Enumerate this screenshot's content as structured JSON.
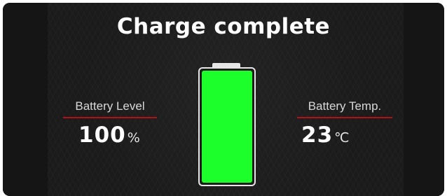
{
  "header": {
    "title": "Charge complete"
  },
  "battery_level": {
    "label": "Battery Level",
    "value": "100",
    "unit": "%"
  },
  "battery_temp": {
    "label": "Battery Temp.",
    "value": "23",
    "unit": "℃"
  },
  "battery_icon": {
    "icon": "battery-icon",
    "fill_fraction": 1.0,
    "fill_color": "#1cff2a"
  },
  "colors": {
    "accent_underline": "#b0121a",
    "background": "#1b1b1b",
    "text": "#ffffff"
  }
}
